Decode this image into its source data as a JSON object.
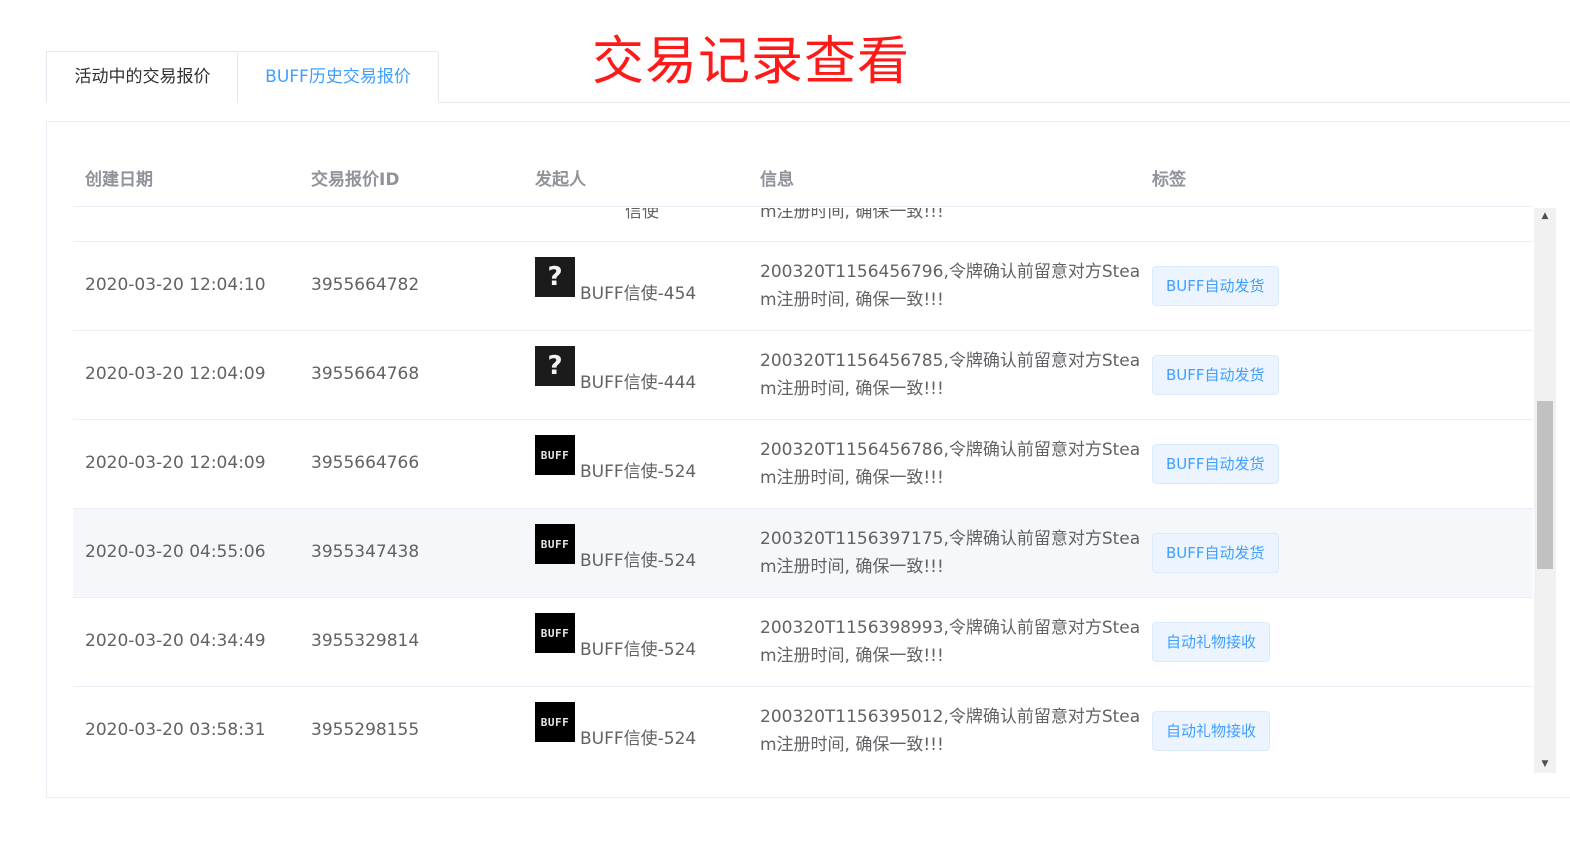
{
  "tabs": [
    {
      "label": "活动中的交易报价",
      "active": false
    },
    {
      "label": "BUFF历史交易报价",
      "active": true
    }
  ],
  "overlay_title": "交易记录查看",
  "table": {
    "columns": [
      "创建日期",
      "交易报价ID",
      "发起人",
      "信息",
      "标签"
    ],
    "partial_row": {
      "sender_name_fragment": "信使",
      "info_line2": "m注册时间, 确保一致!!!"
    },
    "rows": [
      {
        "date": "2020-03-20 12:04:10",
        "id": "3955664782",
        "avatar": "question-avatar",
        "avatar_text": "?",
        "sender": "BUFF信使-454",
        "info_line1": "200320T1156456796,令牌确认前留意对方Stea",
        "info_line2": "m注册时间, 确保一致!!!",
        "tag": "BUFF自动发货"
      },
      {
        "date": "2020-03-20 12:04:09",
        "id": "3955664768",
        "avatar": "question-avatar",
        "avatar_text": "?",
        "sender": "BUFF信使-444",
        "info_line1": "200320T1156456785,令牌确认前留意对方Stea",
        "info_line2": "m注册时间, 确保一致!!!",
        "tag": "BUFF自动发货"
      },
      {
        "date": "2020-03-20 12:04:09",
        "id": "3955664766",
        "avatar": "buff-logo-avatar",
        "avatar_text": "BUFF",
        "sender": "BUFF信使-524",
        "info_line1": "200320T1156456786,令牌确认前留意对方Stea",
        "info_line2": "m注册时间, 确保一致!!!",
        "tag": "BUFF自动发货"
      },
      {
        "date": "2020-03-20 04:55:06",
        "id": "3955347438",
        "avatar": "buff-logo-avatar",
        "avatar_text": "BUFF",
        "sender": "BUFF信使-524",
        "info_line1": "200320T1156397175,令牌确认前留意对方Stea",
        "info_line2": "m注册时间, 确保一致!!!",
        "tag": "BUFF自动发货",
        "hovered": true
      },
      {
        "date": "2020-03-20 04:34:49",
        "id": "3955329814",
        "avatar": "buff-logo-avatar",
        "avatar_text": "BUFF",
        "sender": "BUFF信使-524",
        "info_line1": "200320T1156398993,令牌确认前留意对方Stea",
        "info_line2": "m注册时间, 确保一致!!!",
        "tag": "自动礼物接收"
      },
      {
        "date": "2020-03-20 03:58:31",
        "id": "3955298155",
        "avatar": "buff-logo-avatar",
        "avatar_text": "BUFF",
        "sender": "BUFF信使-524",
        "info_line1": "200320T1156395012,令牌确认前留意对方Stea",
        "info_line2": "m注册时间, 确保一致!!!",
        "tag": "自动礼物接收"
      }
    ]
  },
  "scrollbar": {
    "up_icon": "▲",
    "down_icon": "▼"
  },
  "colors": {
    "accent": "#409eff",
    "overlay_title": "#ff1a1a",
    "tag_bg": "#ecf5ff"
  }
}
